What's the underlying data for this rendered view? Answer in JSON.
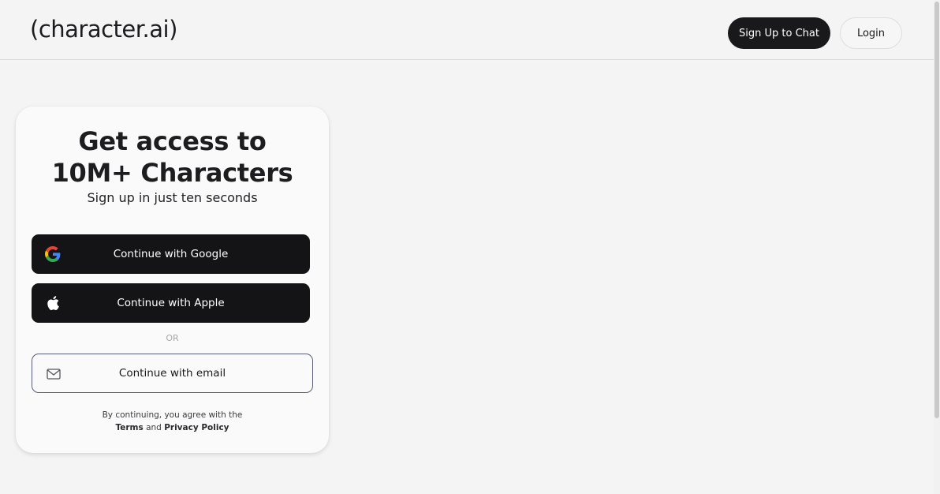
{
  "header": {
    "logo": "(character.ai)",
    "signup_label": "Sign Up to Chat",
    "login_label": "Login"
  },
  "card": {
    "headline_line1": "Get access to",
    "headline_line2": "10M+ Characters",
    "subhead": "Sign up in just ten seconds",
    "google_label": "Continue with Google",
    "apple_label": "Continue with Apple",
    "or_label": "OR",
    "email_label": "Continue with email",
    "legal_prefix": "By continuing, you agree with the",
    "terms_label": "Terms",
    "and_label": "and",
    "privacy_label": "Privacy Policy"
  },
  "icons": {
    "google": "google-icon",
    "apple": "apple-icon",
    "email": "mail-icon"
  },
  "colors": {
    "background": "#f4f4f4",
    "primary_button": "#141416",
    "email_border": "#5b5b7a",
    "google_blue": "#4285F4",
    "google_red": "#EA4335",
    "google_yellow": "#FBBC05",
    "google_green": "#34A853"
  }
}
